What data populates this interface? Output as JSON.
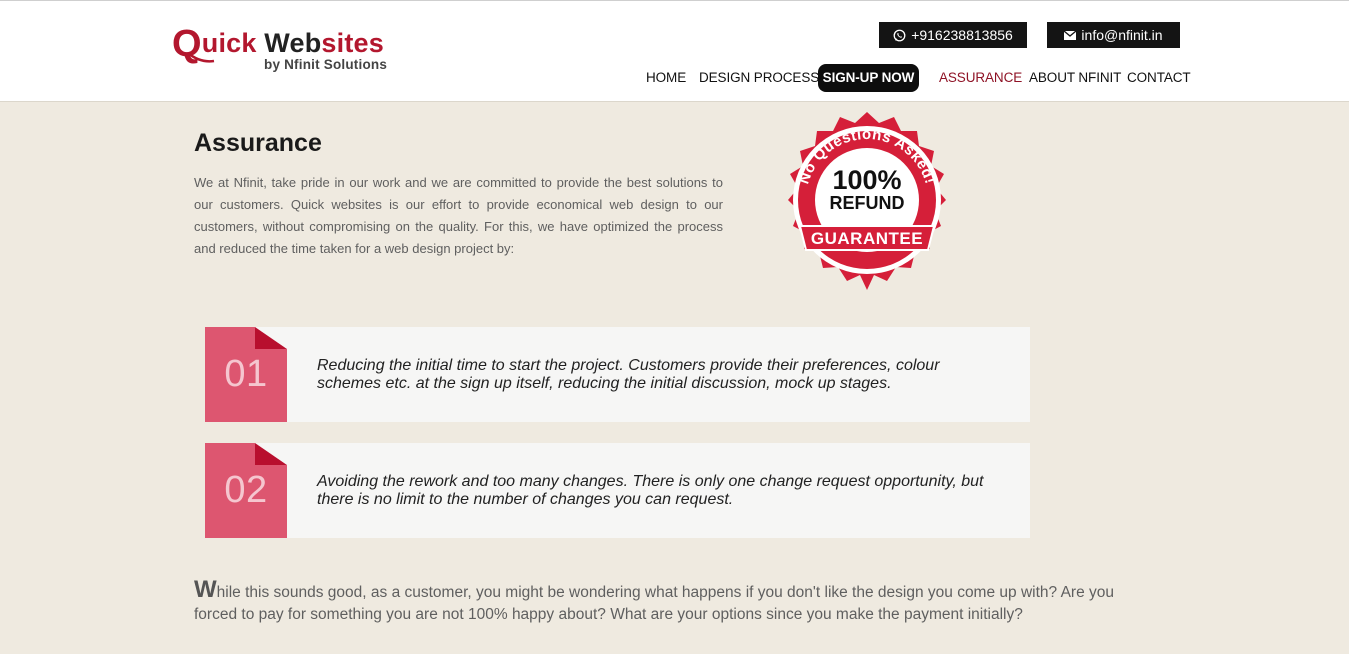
{
  "logo": {
    "q": "Q",
    "w1": "uick",
    "w2": "Web",
    "w3": "sites",
    "sub": "by Nfinit Solutions"
  },
  "contacts": {
    "phone": "+916238813856",
    "phone_icon": "whatsapp-icon",
    "email": "info@nfinit.in",
    "email_icon": "mail-icon"
  },
  "nav": {
    "home": "HOME",
    "design_process": "DESIGN PROCESS",
    "signup": "SIGN-UP NOW",
    "assurance": "ASSURANCE",
    "about": "ABOUT NFINIT",
    "contact": "CONTACT"
  },
  "colors": {
    "brand": "#b3172e",
    "accent_active": "#8f1326",
    "step_pink": "#dd5670",
    "page_bg": "#efeae0"
  },
  "page": {
    "title": "Assurance",
    "intro": "We at Nfinit, take pride in our work and we are committed to provide the best solutions to our customers. Quick websites is our effort to provide economical web design to our customers, without compromising on the quality. For this, we have optimized the process and reduced the time taken for a web design project by:"
  },
  "badge": {
    "arc_text": "No Questions Asked!",
    "percent": "100%",
    "refund": "REFUND",
    "guarantee": "GUARANTEE"
  },
  "steps": [
    {
      "number": "01",
      "text": "Reducing the initial time to start the project. Customers provide their preferences, colour schemes etc. at the sign up itself, reducing the initial discussion, mock up stages."
    },
    {
      "number": "02",
      "text": "Avoiding the rework and too many changes. There is only one change request opportunity, but there is no limit to the number of changes you can request."
    }
  ],
  "closing": {
    "dropcap": "W",
    "rest": "hile this sounds good, as a customer, you might be wondering what happens if you don't like the design you come up with? Are you forced to pay for something you are not 100% happy about? What are your options since you make the payment initially?"
  }
}
